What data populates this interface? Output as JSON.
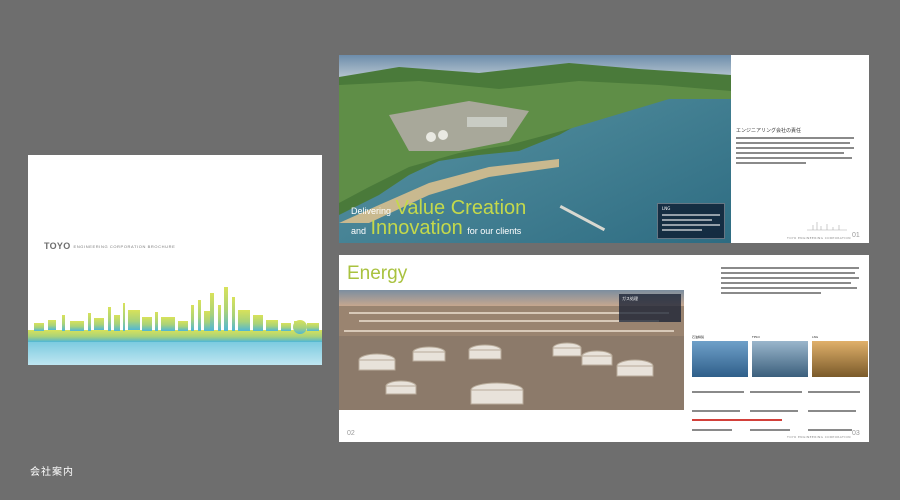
{
  "cover": {
    "brand": "TOYO",
    "subtitle": "ENGINEERING CORPORATION BROCHURE"
  },
  "spread1": {
    "headline_prefix1": "Delivering",
    "headline_big1": "Value Creation",
    "headline_prefix2": "and",
    "headline_big2": "Innovation",
    "headline_suffix2": "for our clients",
    "info_label": "LNG",
    "section_title": "エンジニアリング会社の責任",
    "page_number": "01",
    "footer_logo": "TOYO ENGINEERING CORPORATION"
  },
  "spread2": {
    "section_title": "Energy",
    "photo_label": "ガス処理",
    "thumbs": [
      "石油精製",
      "FPSO",
      "LNG"
    ],
    "page_left": "02",
    "page_right": "03",
    "footer_logo": "TOYO ENGINEERING CORPORATION"
  },
  "caption": "会社案内",
  "colors": {
    "background": "#6e6e6e",
    "accent_green": "#c4d94b",
    "energy_green": "#a9c23f"
  }
}
